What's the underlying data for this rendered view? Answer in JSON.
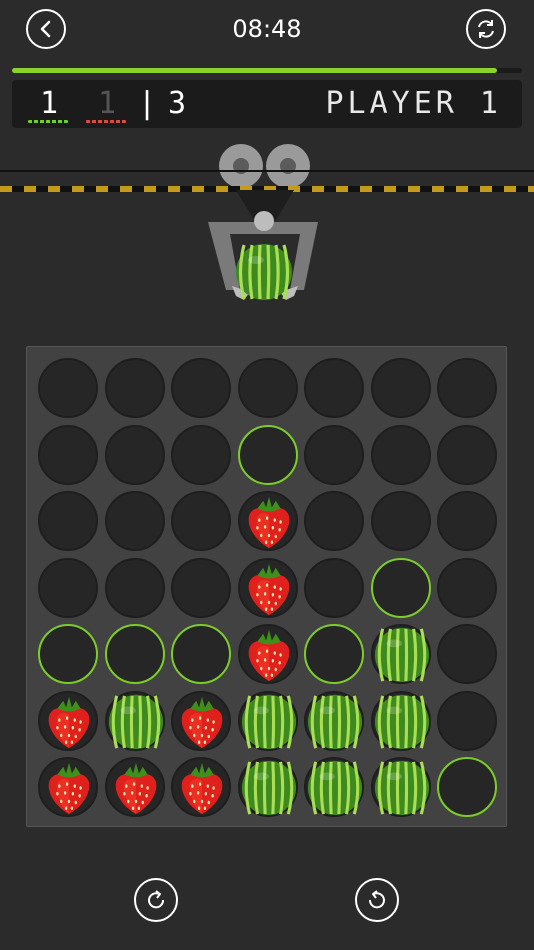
{
  "header": {
    "timer": "08:48",
    "back_icon": "chevron-left-icon",
    "restart_icon": "refresh-icon"
  },
  "progress": {
    "fraction": 0.95,
    "color": "#8bd32a"
  },
  "score": {
    "player1": "1",
    "player2": "1",
    "separator": "|",
    "round": "3",
    "current_player": "PLAYER 1",
    "player1_color": "#6fcf2a",
    "player2_color": "#e04a3a"
  },
  "claw": {
    "holding": "W"
  },
  "board": {
    "rows": [
      [
        ".",
        ".",
        ".",
        ".",
        ".",
        ".",
        "."
      ],
      [
        ".",
        ".",
        ".",
        "h",
        ".",
        ".",
        "."
      ],
      [
        ".",
        ".",
        ".",
        "S",
        ".",
        ".",
        "."
      ],
      [
        ".",
        ".",
        ".",
        "S",
        ".",
        "h",
        "."
      ],
      [
        "h",
        "h",
        "h",
        "S",
        "h",
        "W",
        "."
      ],
      [
        "S",
        "W",
        "S",
        "W",
        "W",
        "W",
        "."
      ],
      [
        "S",
        "S",
        "S",
        "W",
        "W",
        "W",
        "h"
      ]
    ],
    "legend": {
      "S": "strawberry",
      "W": "watermelon",
      "h": "highlighted-empty",
      ".": "empty"
    }
  },
  "controls": {
    "redo_icon": "rotate-clockwise-icon",
    "undo_icon": "rotate-counterclockwise-icon"
  }
}
